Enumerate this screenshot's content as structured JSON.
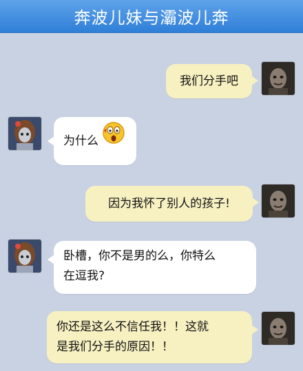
{
  "header": {
    "title": "奔波儿妹与灞波儿奔"
  },
  "messages": [
    {
      "side": "out",
      "text": "我们分手吧",
      "avatar": "male-avatar"
    },
    {
      "side": "in",
      "text": "为什么",
      "emoji": "surprised-face-emoji",
      "avatar": "female-avatar"
    },
    {
      "side": "out",
      "text": "因为我怀了别人的孩子!",
      "avatar": "male-avatar"
    },
    {
      "side": "in",
      "lines": [
        "卧槽，你不是男的么，你特么",
        "在逗我?"
      ],
      "avatar": "female-avatar"
    },
    {
      "side": "out",
      "lines": [
        "你还是这么不信任我！！这就",
        "是我们分手的原因！！"
      ],
      "avatar": "male-avatar"
    }
  ],
  "colors": {
    "header": "#3f8fe2",
    "background": "#c9d2e3",
    "out_bubble": "#f7f1c2",
    "in_bubble": "#ffffff"
  }
}
